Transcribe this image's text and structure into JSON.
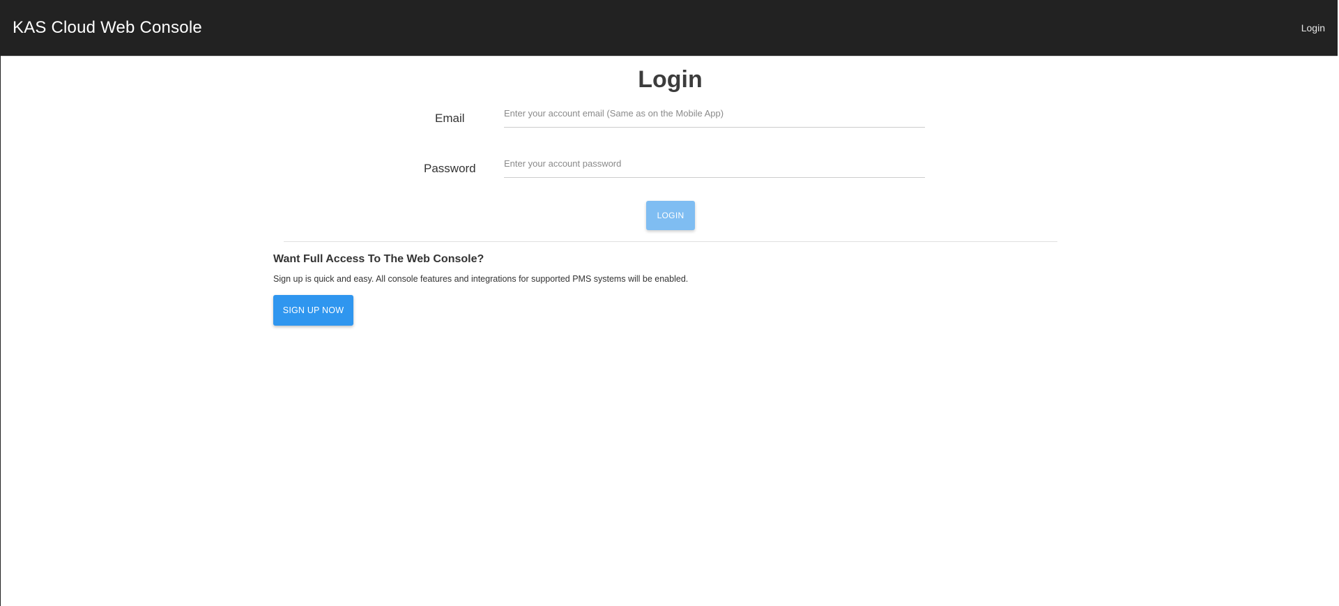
{
  "header": {
    "brand": "KAS Cloud Web Console",
    "nav_login": "Login"
  },
  "login": {
    "title": "Login",
    "email_label": "Email",
    "email_placeholder": "Enter your account email (Same as on the Mobile App)",
    "email_value": "",
    "password_label": "Password",
    "password_placeholder": "Enter your account password",
    "password_value": "",
    "button_label": "LOGIN"
  },
  "signup": {
    "heading": "Want Full Access To The Web Console?",
    "text": "Sign up is quick and easy. All console features and integrations for supported PMS systems will be enabled.",
    "button_label": "SIGN UP NOW"
  },
  "colors": {
    "topbar": "#222222",
    "login_button": "#7fbdf2",
    "signup_button": "#2f96ef"
  }
}
